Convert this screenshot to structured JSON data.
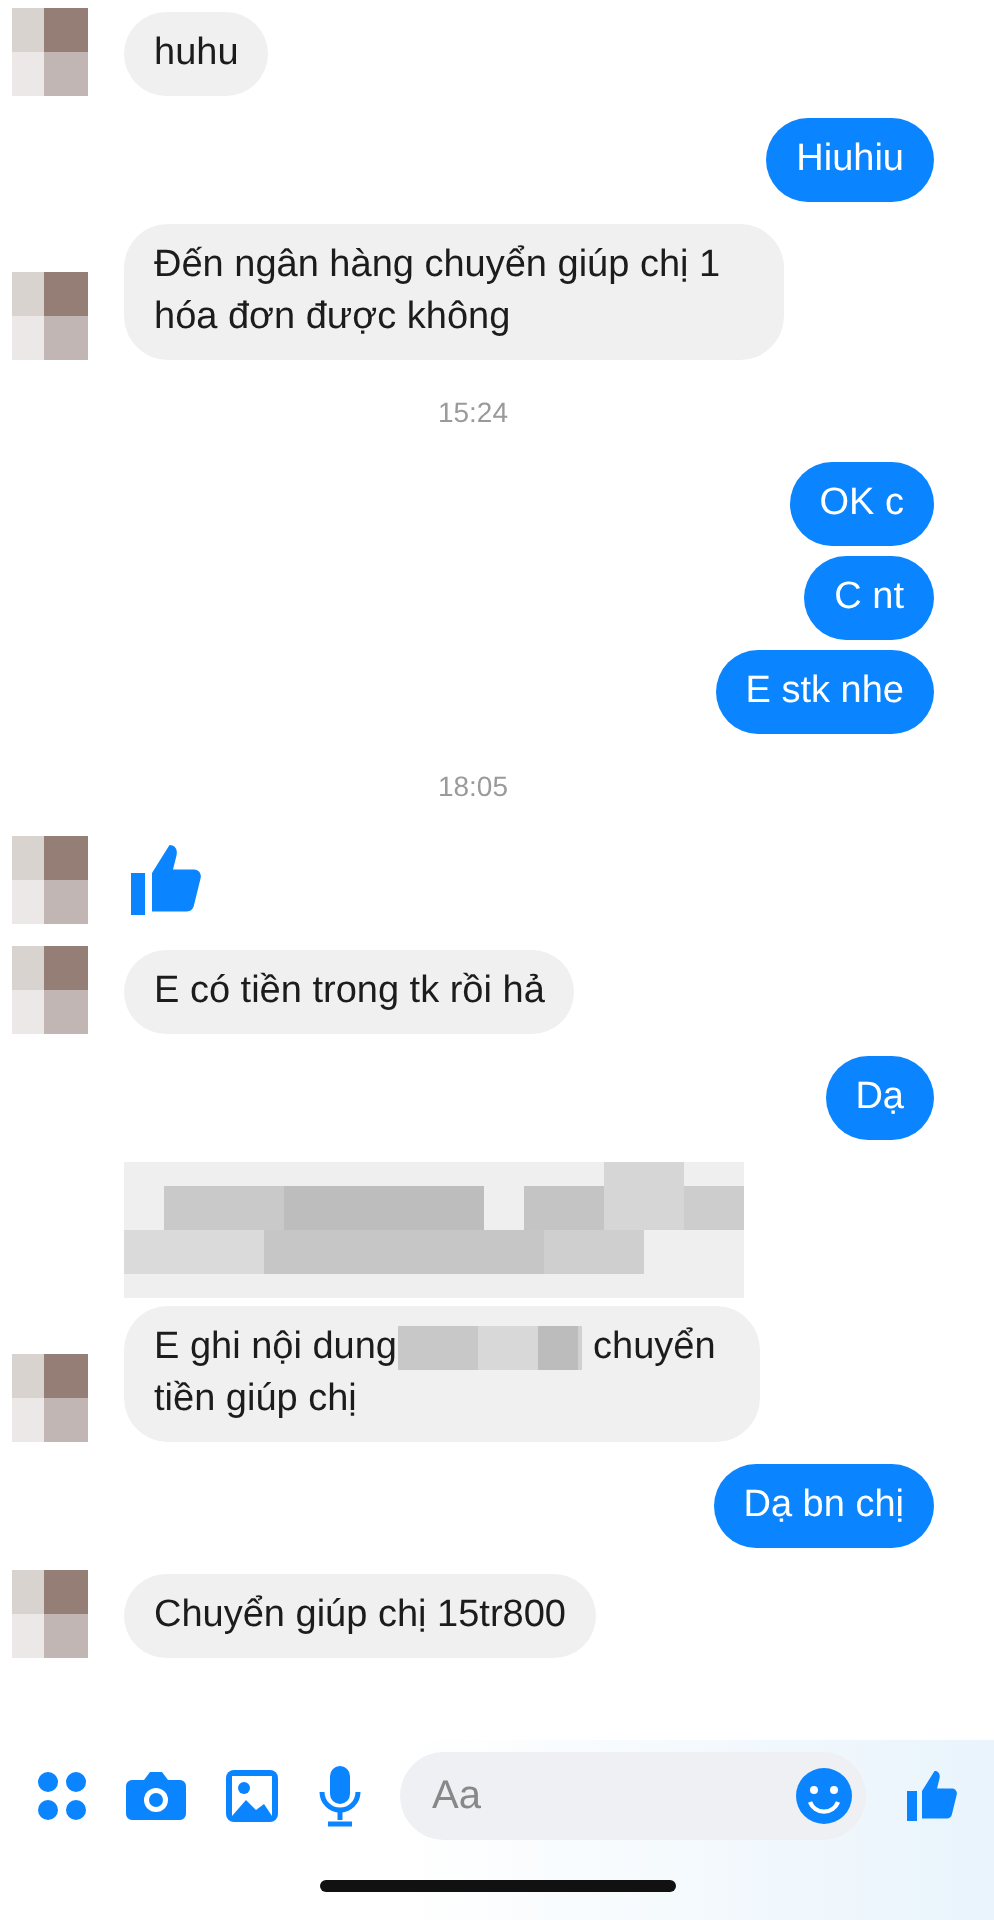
{
  "messages": [
    {
      "kind": "incoming",
      "avatar": true,
      "text": "huhu"
    },
    {
      "kind": "outgoing",
      "text": "Hiuhiu"
    },
    {
      "kind": "incoming",
      "avatar": true,
      "text": "Đến ngân hàng chuyển giúp chị 1 hóa đơn được không"
    },
    {
      "kind": "time",
      "text": "15:24"
    },
    {
      "kind": "outgoing",
      "text": "OK c"
    },
    {
      "kind": "outgoing",
      "text": "C nt"
    },
    {
      "kind": "outgoing",
      "text": "E stk nhe"
    },
    {
      "kind": "time",
      "text": "18:05"
    },
    {
      "kind": "like",
      "avatar": true
    },
    {
      "kind": "incoming",
      "avatar": true,
      "text": "E có tiền trong tk rồi hả"
    },
    {
      "kind": "outgoing",
      "text": "Dạ"
    },
    {
      "kind": "redacted",
      "avatar": false
    },
    {
      "kind": "split",
      "avatar": true,
      "before": "E ghi nội dung",
      "after": "chuyển",
      "second_line": "tiền giúp chị"
    },
    {
      "kind": "outgoing",
      "text": "Dạ bn chị"
    },
    {
      "kind": "incoming",
      "avatar": true,
      "text": "Chuyển giúp chị 15tr800"
    }
  ],
  "composer": {
    "placeholder": "Aa"
  }
}
